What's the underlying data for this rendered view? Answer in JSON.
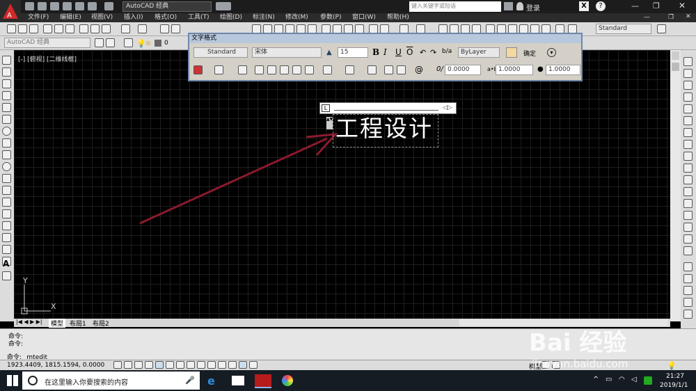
{
  "titlebar": {
    "workspace": "AutoCAD 经典",
    "search_placeholder": "键入关键字或短语",
    "login": "登录"
  },
  "menu": [
    "文件(F)",
    "编辑(E)",
    "视图(V)",
    "插入(I)",
    "格式(O)",
    "工具(T)",
    "绘图(D)",
    "标注(N)",
    "修改(M)",
    "参数(P)",
    "窗口(W)",
    "帮助(H)"
  ],
  "toolbar": {
    "workspace_combo": "AutoCAD 经典",
    "text_style": "Standard",
    "layer_value": "0"
  },
  "text_formatting": {
    "title": "文字格式",
    "style": "Standard",
    "font": "宋体",
    "height": "15",
    "color": "ByLayer",
    "ok_label": "确定",
    "oblique": "0.0000",
    "tracking": "1.0000",
    "width_factor": "1.0000"
  },
  "canvas": {
    "view_label": "[-] [俯视] [二维线框]",
    "mtext": "工程设计",
    "axis_y": "Y",
    "axis_x": "X",
    "arrow_color": "#8b1a2e"
  },
  "layout_tabs": [
    "模型",
    "布局1",
    "布局2"
  ],
  "command": {
    "lines": [
      "命令:",
      "命令:"
    ],
    "prompt": "命令:  _mtedit"
  },
  "status": {
    "coords": "1923.4409,  1815.1594,  0.0000",
    "model_label": "模型"
  },
  "taskbar": {
    "search_placeholder": "在这里输入你要搜索的内容",
    "time": "21:27",
    "date": "2019/1/1"
  },
  "watermark": {
    "brand": "Bai 经验",
    "url": "jingyan.baidu.com"
  }
}
